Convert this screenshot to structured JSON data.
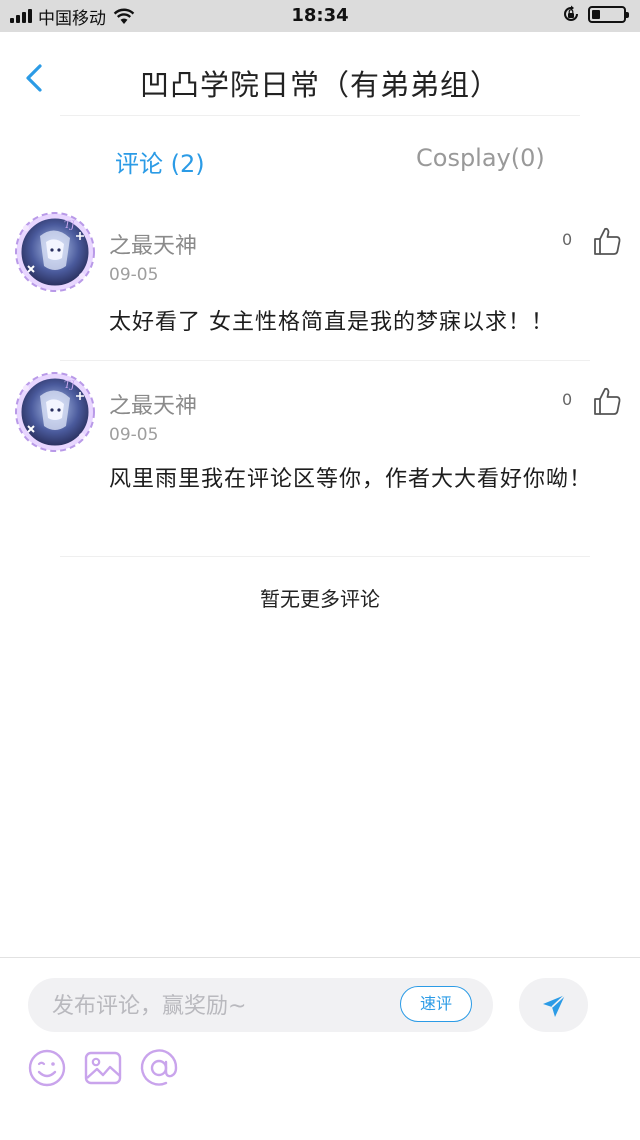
{
  "status_bar": {
    "carrier": "中国移动",
    "time": "18:34",
    "battery_level": 0.25
  },
  "header": {
    "title": "凹凸学院日常（有弟弟组）",
    "back_icon": "chevron-left-icon"
  },
  "tabs": [
    {
      "label": "评论 (2)",
      "active": true
    },
    {
      "label": "Cosplay(0)",
      "active": false
    }
  ],
  "comments": [
    {
      "author": "之最天神",
      "date": "09-05",
      "text": "太好看了 女主性格简直是我的梦寐以求！！",
      "likes": "0"
    },
    {
      "author": "之最天神",
      "date": "09-05",
      "text": "风里雨里我在评论区等你，作者大大看好你呦！",
      "likes": "0"
    }
  ],
  "no_more_text": "暂无更多评论",
  "input": {
    "placeholder": "发布评论，赢奖励~",
    "value": "",
    "quick_label": "速评"
  },
  "tools": [
    "emoji-icon",
    "image-icon",
    "mention-icon"
  ],
  "colors": {
    "accent": "#2b9be6",
    "tool_purple": "#c9a4ec",
    "muted_text": "#8a8a8a"
  }
}
